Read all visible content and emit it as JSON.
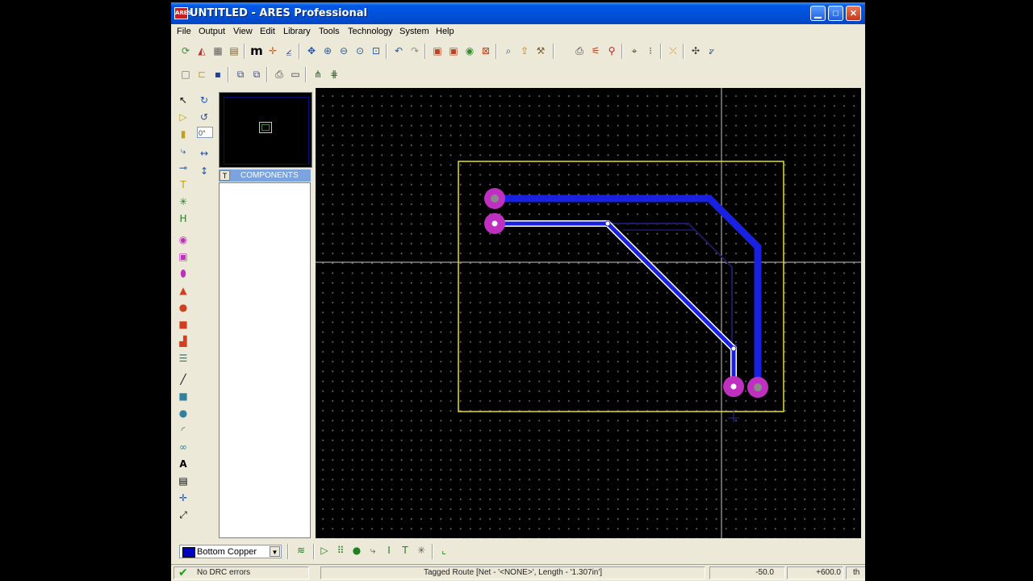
{
  "window": {
    "app_icon_text": "ARES",
    "title": "UNTITLED - ARES Professional",
    "minimize_glyph": "▁",
    "maximize_glyph": "□",
    "close_glyph": "✕"
  },
  "menu": [
    "File",
    "Output",
    "View",
    "Edit",
    "Library",
    "Tools",
    "Technology",
    "System",
    "Help"
  ],
  "toolbar": {
    "mode_glyph": "m"
  },
  "rotation": {
    "angle_value": "0°"
  },
  "selector": {
    "mode_label": "T",
    "title": "COMPONENTS"
  },
  "bottom": {
    "layer": "Bottom Copper",
    "dropdown_glyph": "▼"
  },
  "status": {
    "drc": "No DRC errors",
    "message": "Tagged Route [Net - '<NONE>', Length - '1.307in']",
    "x": "-50.0",
    "y": "+600.0",
    "units": "th"
  },
  "colors": {
    "board_edge": "#e8e020",
    "track_bottom": "#1a20e0",
    "pad": "#c030c0",
    "pad_hole": "#8a8a8a",
    "crosshair": "#c8c8c8"
  }
}
